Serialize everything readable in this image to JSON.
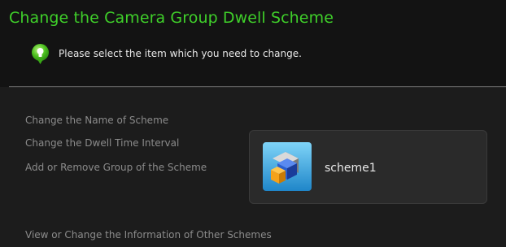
{
  "header": {
    "title": "Change the Camera Group Dwell Scheme",
    "hint": "Please select the item which you need  to change."
  },
  "options": [
    {
      "label": "Change the Name of Scheme"
    },
    {
      "label": "Change the Dwell Time Interval"
    },
    {
      "label": "Add or Remove Group of the Scheme"
    }
  ],
  "scheme": {
    "name": "scheme1",
    "icon": "scheme-cubes-icon"
  },
  "footer_link": "View or Change the Information of Other Schemes",
  "colors": {
    "title_green": "#3fcf2a",
    "link_gray": "#8b8b8b",
    "background": "#1c1c1c"
  }
}
